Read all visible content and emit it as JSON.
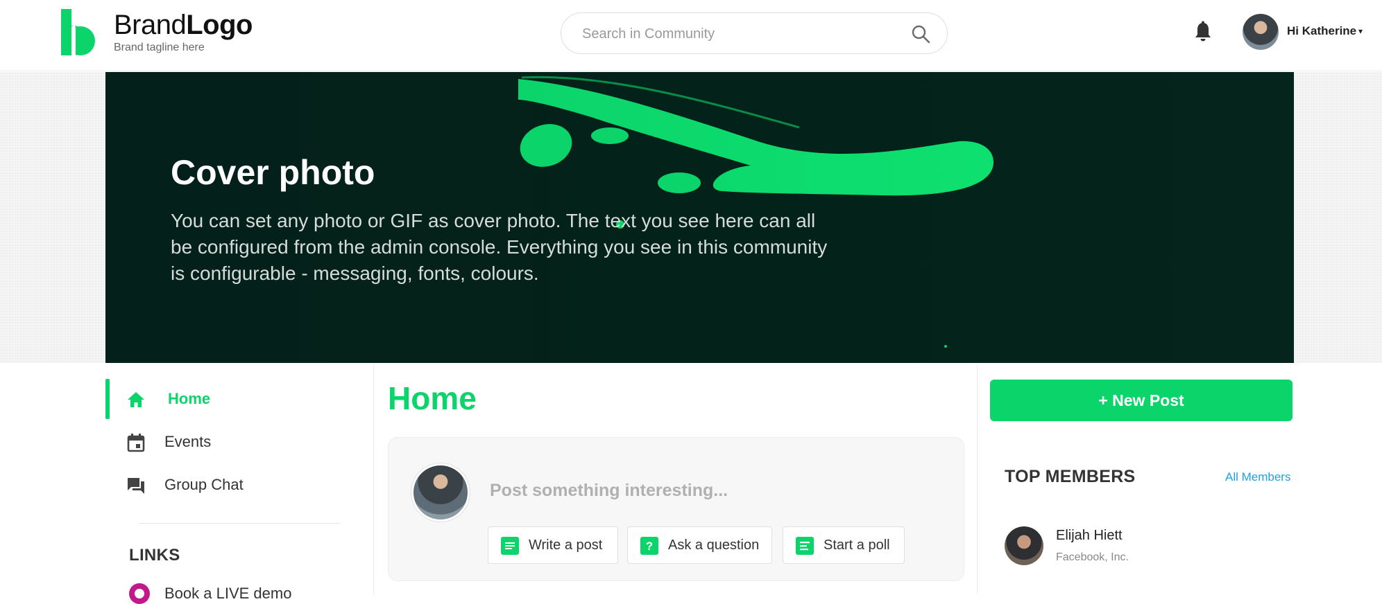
{
  "header": {
    "logo_word_1": "Brand",
    "logo_word_2": "Logo",
    "tagline": "Brand tagline here",
    "search_placeholder": "Search in Community",
    "user_greeting": "Hi Katherine",
    "user_caret": "▾",
    "icons": [
      "logo-mark-icon",
      "search-icon",
      "bell-icon",
      "chevron-down-icon"
    ]
  },
  "cover": {
    "title": "Cover photo",
    "text": "You can set any photo or GIF as cover photo. The text you see here can all be configured from the admin console. Everything you see in this community is configurable - messaging, fonts, colours."
  },
  "nav": {
    "items": [
      {
        "label": "Home",
        "icon": "home-icon",
        "active": true
      },
      {
        "label": "Events",
        "icon": "calendar-icon",
        "active": false
      },
      {
        "label": "Group Chat",
        "icon": "chat-icon",
        "active": false
      }
    ],
    "links_heading": "LINKS",
    "links": [
      {
        "label": "Book a LIVE demo",
        "icon": "demo-link-icon"
      }
    ]
  },
  "main": {
    "title": "Home",
    "composer": {
      "placeholder": "Post something interesting...",
      "buttons": [
        {
          "label": "Write a post",
          "icon": "write-post-icon"
        },
        {
          "label": "Ask a question",
          "icon": "question-icon"
        },
        {
          "label": "Start a poll",
          "icon": "poll-icon"
        }
      ]
    }
  },
  "sidebar": {
    "new_post_label": "+  New Post",
    "top_members_heading": "TOP MEMBERS",
    "all_members_label": "All Members",
    "members": [
      {
        "name": "Elijah Hiett",
        "company": "Facebook, Inc."
      }
    ]
  },
  "colors": {
    "accent": "#0bd46b",
    "link": "#1aa3e0",
    "cover_bg": "#032219"
  }
}
